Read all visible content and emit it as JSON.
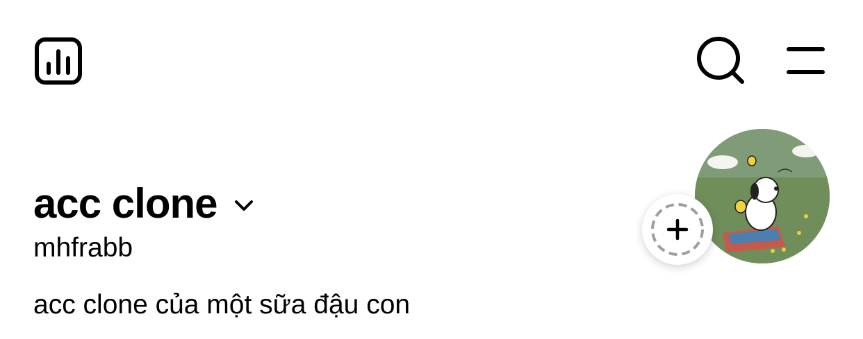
{
  "header": {
    "icons": [
      "insights-icon",
      "search-icon",
      "menu-icon"
    ]
  },
  "profile": {
    "display_name": "acc clone",
    "username": "mhfrabb",
    "bio": "acc clone của một sữa đậu con",
    "avatar": "snoopy-picnic-avatar",
    "add_note_icon": "plus-icon"
  },
  "colors": {
    "text": "#000000",
    "background": "#ffffff",
    "avatar_bg": "#7f9b78",
    "dashed_ring": "#9e9e9e"
  }
}
